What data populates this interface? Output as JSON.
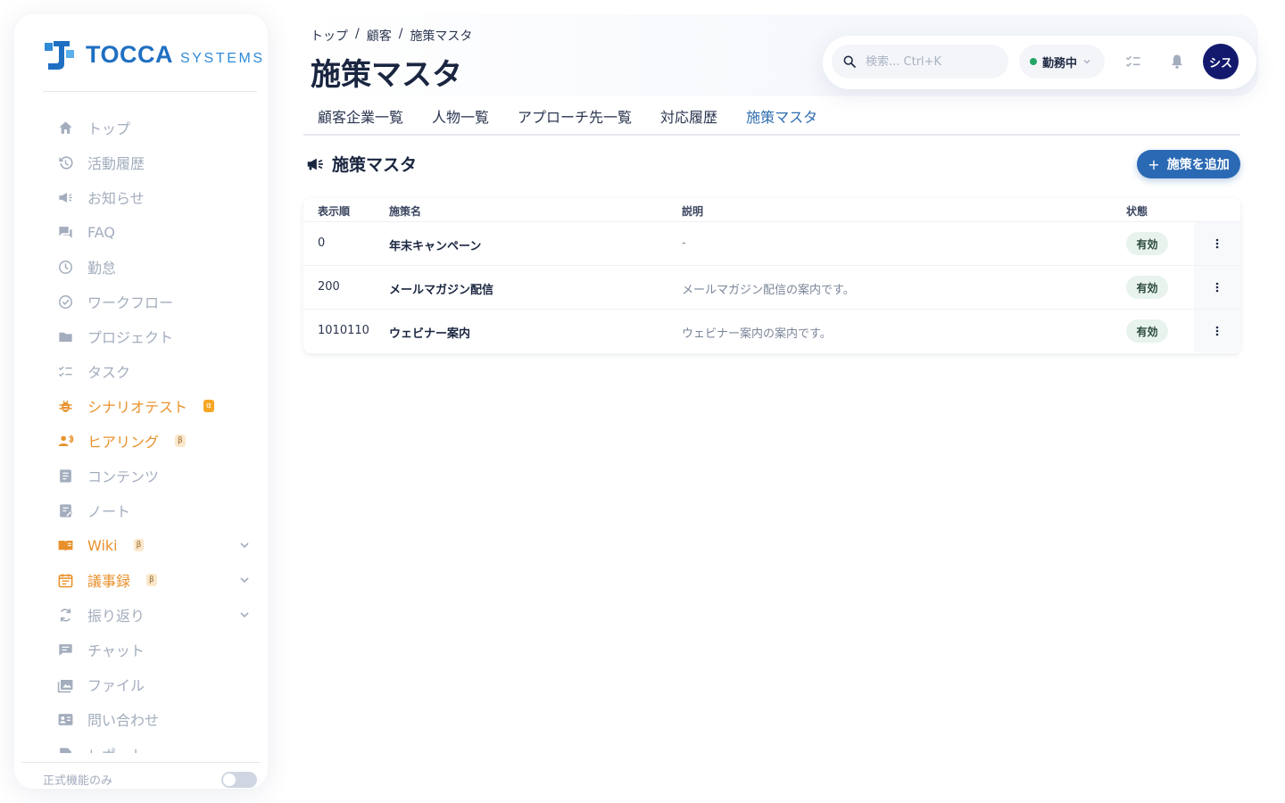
{
  "brand": {
    "name": "TOCCA",
    "sub": "SYSTEMS"
  },
  "sidebar": {
    "items": [
      {
        "label": "トップ",
        "icon": "home-icon",
        "badge": "",
        "expand": false,
        "accent": false
      },
      {
        "label": "活動履歴",
        "icon": "history-icon",
        "badge": "",
        "expand": false,
        "accent": false
      },
      {
        "label": "お知らせ",
        "icon": "megaphone-icon",
        "badge": "",
        "expand": false,
        "accent": false
      },
      {
        "label": "FAQ",
        "icon": "forum-icon",
        "badge": "",
        "expand": false,
        "accent": false
      },
      {
        "label": "勤怠",
        "icon": "clock-icon",
        "badge": "",
        "expand": false,
        "accent": false
      },
      {
        "label": "ワークフロー",
        "icon": "check-circle-icon",
        "badge": "",
        "expand": false,
        "accent": false
      },
      {
        "label": "プロジェクト",
        "icon": "folder-icon",
        "badge": "",
        "expand": false,
        "accent": false
      },
      {
        "label": "タスク",
        "icon": "checklist-icon",
        "badge": "",
        "expand": false,
        "accent": false
      },
      {
        "label": "シナリオテスト",
        "icon": "bug-icon",
        "badge": "α",
        "expand": false,
        "accent": true
      },
      {
        "label": "ヒアリング",
        "icon": "people-icon",
        "badge": "β",
        "expand": false,
        "accent": true
      },
      {
        "label": "コンテンツ",
        "icon": "document-icon",
        "badge": "",
        "expand": false,
        "accent": false
      },
      {
        "label": "ノート",
        "icon": "note-icon",
        "badge": "",
        "expand": false,
        "accent": false
      },
      {
        "label": "Wiki",
        "icon": "book-icon",
        "badge": "β",
        "expand": true,
        "accent": true
      },
      {
        "label": "議事録",
        "icon": "calendar-icon",
        "badge": "β",
        "expand": true,
        "accent": true
      },
      {
        "label": "振り返り",
        "icon": "refresh-icon",
        "badge": "",
        "expand": true,
        "accent": false
      },
      {
        "label": "チャット",
        "icon": "chat-icon",
        "badge": "",
        "expand": false,
        "accent": false
      },
      {
        "label": "ファイル",
        "icon": "image-icon",
        "badge": "",
        "expand": false,
        "accent": false
      },
      {
        "label": "問い合わせ",
        "icon": "contact-card-icon",
        "badge": "",
        "expand": false,
        "accent": false
      },
      {
        "label": "レポート",
        "icon": "report-icon",
        "badge": "",
        "expand": false,
        "accent": false
      }
    ],
    "footer_label": "正式機能のみ",
    "footer_toggle_on": false
  },
  "header": {
    "breadcrumb": [
      "トップ",
      "顧客",
      "施策マスタ"
    ],
    "title": "施策マスタ",
    "search_placeholder": "検索... Ctrl+K",
    "status_label": "勤務中",
    "avatar_label": "シス"
  },
  "tabs": [
    {
      "label": "顧客企業一覧",
      "active": false
    },
    {
      "label": "人物一覧",
      "active": false
    },
    {
      "label": "アプローチ先一覧",
      "active": false
    },
    {
      "label": "対応履歴",
      "active": false
    },
    {
      "label": "施策マスタ",
      "active": true
    }
  ],
  "section": {
    "title": "施策マスタ",
    "add_button": "施策を追加"
  },
  "table": {
    "columns": [
      "表示順",
      "施策名",
      "説明",
      "状態"
    ],
    "rows": [
      {
        "order": "0",
        "name": "年末キャンペーン",
        "description": "-",
        "status": "有効"
      },
      {
        "order": "200",
        "name": "メールマガジン配信",
        "description": "メールマガジン配信の案内です。",
        "status": "有効"
      },
      {
        "order": "1010110",
        "name": "ウェビナー案内",
        "description": "ウェビナー案内の案内です。",
        "status": "有効"
      }
    ]
  },
  "colors": {
    "accent": "#2a69b3",
    "orange": "#e8912c",
    "muted": "#a3adbd",
    "status_green": "#22a565",
    "avatar": "#131a6e"
  }
}
